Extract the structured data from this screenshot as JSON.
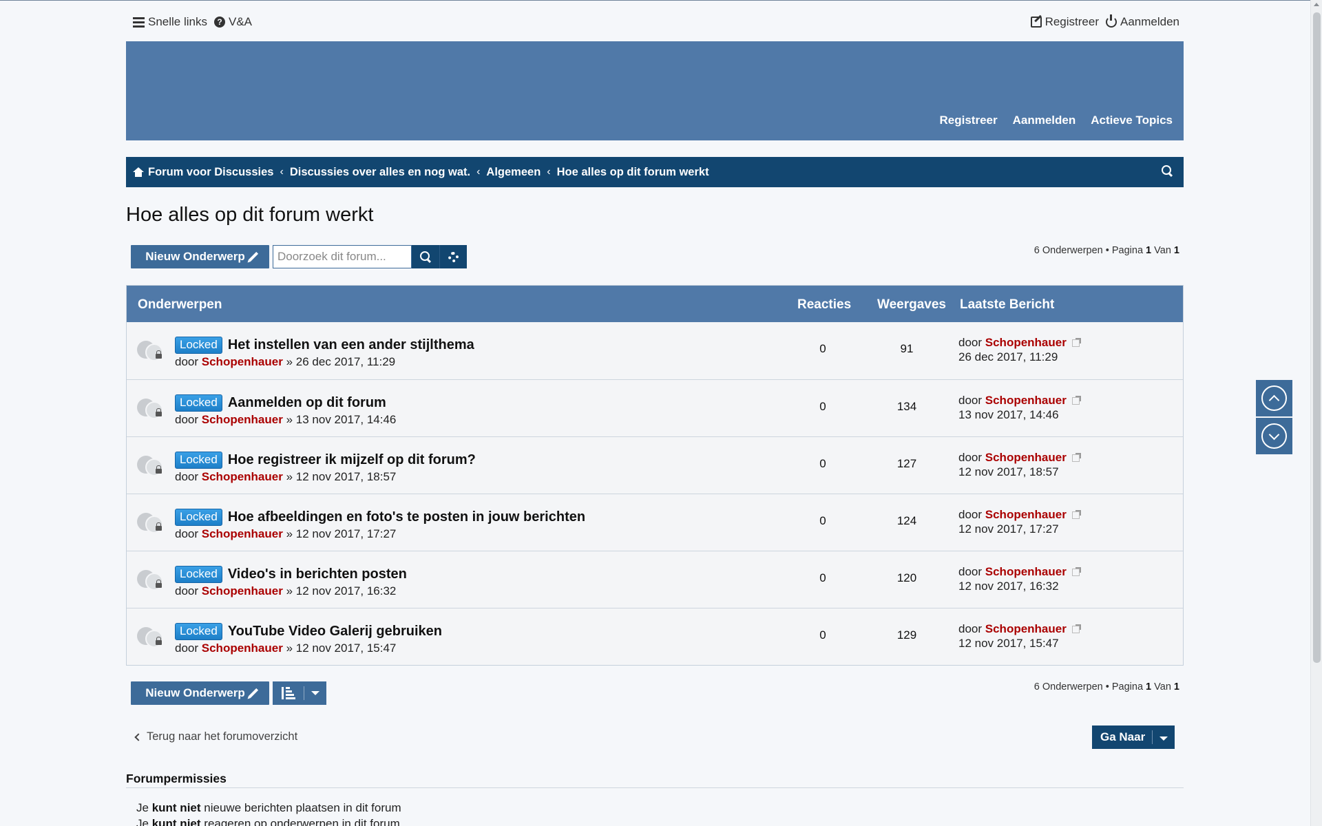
{
  "quicklinks": {
    "snelle_links": "Snelle links",
    "faq": "V&A",
    "register": "Registreer",
    "login": "Aanmelden"
  },
  "banner_nav": [
    "Registreer",
    "Aanmelden",
    "Actieve Topics"
  ],
  "breadcrumbs": [
    "Forum voor Discussies",
    "Discussies over alles en nog wat.",
    "Algemeen",
    "Hoe alles op dit forum werkt"
  ],
  "breadcrumb_sep": "‹",
  "page_title": "Hoe alles op dit forum werkt",
  "new_topic_label": "Nieuw Onderwerp",
  "search_placeholder": "Doorzoek dit forum...",
  "pagination": {
    "count_text": "6 Onderwerpen • Pagina",
    "current": "1",
    "of": "Van",
    "total": "1"
  },
  "table": {
    "headers": {
      "topics": "Onderwerpen",
      "replies": "Reacties",
      "views": "Weergaves",
      "last_post": "Laatste Bericht"
    },
    "rows": [
      {
        "badge": "Locked",
        "title": "Het instellen van een ander stijlthema",
        "by": "door",
        "author": "Schopenhauer",
        "sep": "»",
        "date": "26 dec 2017, 11:29",
        "replies": "0",
        "views": "91",
        "last_by": "door",
        "last_author": "Schopenhauer",
        "last_date": "26 dec 2017, 11:29"
      },
      {
        "badge": "Locked",
        "title": "Aanmelden op dit forum",
        "by": "door",
        "author": "Schopenhauer",
        "sep": "»",
        "date": "13 nov 2017, 14:46",
        "replies": "0",
        "views": "134",
        "last_by": "door",
        "last_author": "Schopenhauer",
        "last_date": "13 nov 2017, 14:46"
      },
      {
        "badge": "Locked",
        "title": "Hoe registreer ik mijzelf op dit forum?",
        "by": "door",
        "author": "Schopenhauer",
        "sep": "»",
        "date": "12 nov 2017, 18:57",
        "replies": "0",
        "views": "127",
        "last_by": "door",
        "last_author": "Schopenhauer",
        "last_date": "12 nov 2017, 18:57"
      },
      {
        "badge": "Locked",
        "title": "Hoe afbeeldingen en foto's te posten in jouw berichten",
        "by": "door",
        "author": "Schopenhauer",
        "sep": "»",
        "date": "12 nov 2017, 17:27",
        "replies": "0",
        "views": "124",
        "last_by": "door",
        "last_author": "Schopenhauer",
        "last_date": "12 nov 2017, 17:27"
      },
      {
        "badge": "Locked",
        "title": "Video's in berichten posten",
        "by": "door",
        "author": "Schopenhauer",
        "sep": "»",
        "date": "12 nov 2017, 16:32",
        "replies": "0",
        "views": "120",
        "last_by": "door",
        "last_author": "Schopenhauer",
        "last_date": "12 nov 2017, 16:32"
      },
      {
        "badge": "Locked",
        "title": "YouTube Video Galerij gebruiken",
        "by": "door",
        "author": "Schopenhauer",
        "sep": "»",
        "date": "12 nov 2017, 15:47",
        "replies": "0",
        "views": "129",
        "last_by": "door",
        "last_author": "Schopenhauer",
        "last_date": "12 nov 2017, 15:47"
      }
    ]
  },
  "back_link": "Terug naar het forumoverzicht",
  "jump_label": "Ga Naar",
  "permissions": {
    "heading": "Forumpermissies",
    "lines": [
      {
        "pre": "Je",
        "bold": "kunt niet",
        "post": "nieuwe berichten plaatsen in dit forum"
      },
      {
        "pre": "Je",
        "bold": "kunt niet",
        "post": "reageren op onderwerpen in dit forum"
      }
    ]
  },
  "colors": {
    "banner": "#5079a8",
    "navbar": "#124670",
    "button": "#3d6b99",
    "author": "#aa0000",
    "badge": "#1d7fc8"
  }
}
